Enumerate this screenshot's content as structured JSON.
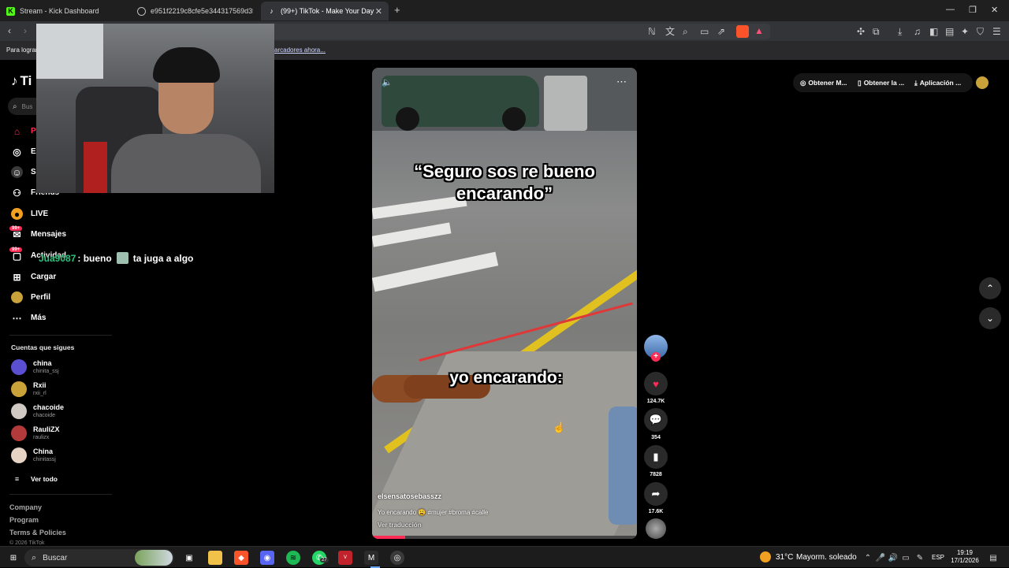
{
  "browser": {
    "tabs": [
      {
        "title": "Stream - Kick Dashboard",
        "icon": "kick-icon"
      },
      {
        "title": "e951f2219c8cfe5e344317569d3548",
        "icon": "globe-icon"
      },
      {
        "title": "(99+) TikTok - Make Your Day",
        "icon": "tiktok-icon"
      }
    ],
    "new_tab": "+",
    "infobar_text": "Para lograr",
    "infobar_link": "arcadores ahora..."
  },
  "tiktok": {
    "logo": "Ti",
    "search_placeholder": "Bus",
    "nav": [
      {
        "label": "P",
        "icon": "home-icon"
      },
      {
        "label": "E",
        "icon": "compass-icon"
      },
      {
        "label": "S",
        "icon": "following-icon"
      },
      {
        "label": "Friends",
        "icon": "friends-icon"
      },
      {
        "label": "LIVE",
        "icon": "live-icon"
      },
      {
        "label": "Mensajes",
        "icon": "messages-icon",
        "badge": "99+"
      },
      {
        "label": "Actividad",
        "icon": "activity-icon",
        "badge": "99+"
      },
      {
        "label": "Cargar",
        "icon": "upload-icon"
      },
      {
        "label": "Perfil",
        "icon": "profile-icon"
      },
      {
        "label": "Más",
        "icon": "more-icon"
      }
    ],
    "following_title": "Cuentas que sigues",
    "following": [
      {
        "name": "china",
        "handle": "chinita_ssj",
        "color": "#5b4fd1"
      },
      {
        "name": "Rxii",
        "handle": "rxii_rl",
        "color": "#c9a23a"
      },
      {
        "name": "chacoide",
        "handle": "chacoide",
        "color": "#d0c9c3"
      },
      {
        "name": "RauliZX",
        "handle": "raulizx",
        "color": "#b33a3a"
      },
      {
        "name": "China",
        "handle": "chinitassj",
        "color": "#e6d3c4"
      }
    ],
    "see_all": "Ver todo",
    "footer": [
      "Company",
      "Program",
      "Terms & Policies",
      "© 2026 TikTok"
    ],
    "top_right": {
      "coins": "Obtener M...",
      "app": "Obtener la ...",
      "download": "Aplicación ..."
    }
  },
  "chat": {
    "user": "Jua9087",
    "message_a": ": bueno",
    "message_b": "ta juga a algo"
  },
  "video": {
    "caption_top": "“Seguro sos re bueno encarando”",
    "caption_bottom": "yo encarando:",
    "author": "elsensatosebasszz",
    "description": "Yo encarando 😩 #mujer #broma #calle",
    "translate": "Ver traducción",
    "actions": [
      {
        "icon": "heart-icon",
        "count": "124.7K"
      },
      {
        "icon": "comment-icon",
        "count": "354"
      },
      {
        "icon": "bookmark-icon",
        "count": "7828"
      },
      {
        "icon": "share-icon",
        "count": "17.6K"
      }
    ]
  },
  "taskbar": {
    "search": "Buscar",
    "whatsapp_badge": "27",
    "weather_temp": "31°C",
    "weather_text": "Mayorm. soleado",
    "lang": "ESP",
    "time": "19:19",
    "date": "17/1/2026"
  },
  "colors": {
    "tiktok_red": "#fe2c55",
    "chat_username": "#2ec27e"
  }
}
